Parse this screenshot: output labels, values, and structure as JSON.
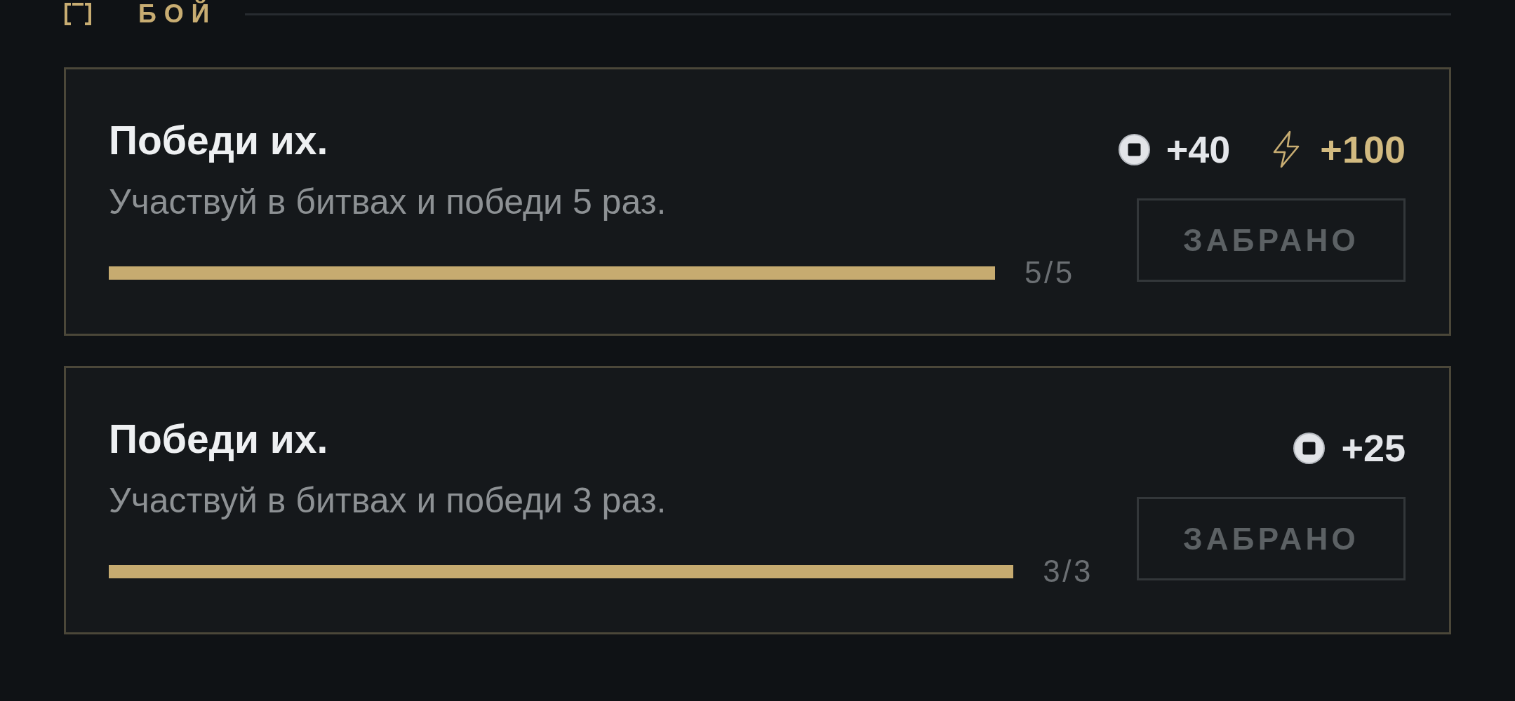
{
  "section": {
    "title": "БОЙ"
  },
  "quests": [
    {
      "title": "Победи их.",
      "description": "Участвуй в битвах и победи 5 раз.",
      "progress": {
        "level": 1,
        "label": "5/5"
      },
      "rewards": [
        {
          "kind": "coin",
          "amount": "+40"
        },
        {
          "kind": "energy",
          "amount": "+100"
        }
      ],
      "button": {
        "label": "ЗАБРАНО",
        "disabled": true
      }
    },
    {
      "title": "Победи их.",
      "description": "Участвуй в битвах и победи 3 раз.",
      "progress": {
        "level": 1,
        "label": "3/3"
      },
      "rewards": [
        {
          "kind": "coin",
          "amount": "+25"
        }
      ],
      "button": {
        "label": "ЗАБРАНО",
        "disabled": true
      }
    }
  ]
}
